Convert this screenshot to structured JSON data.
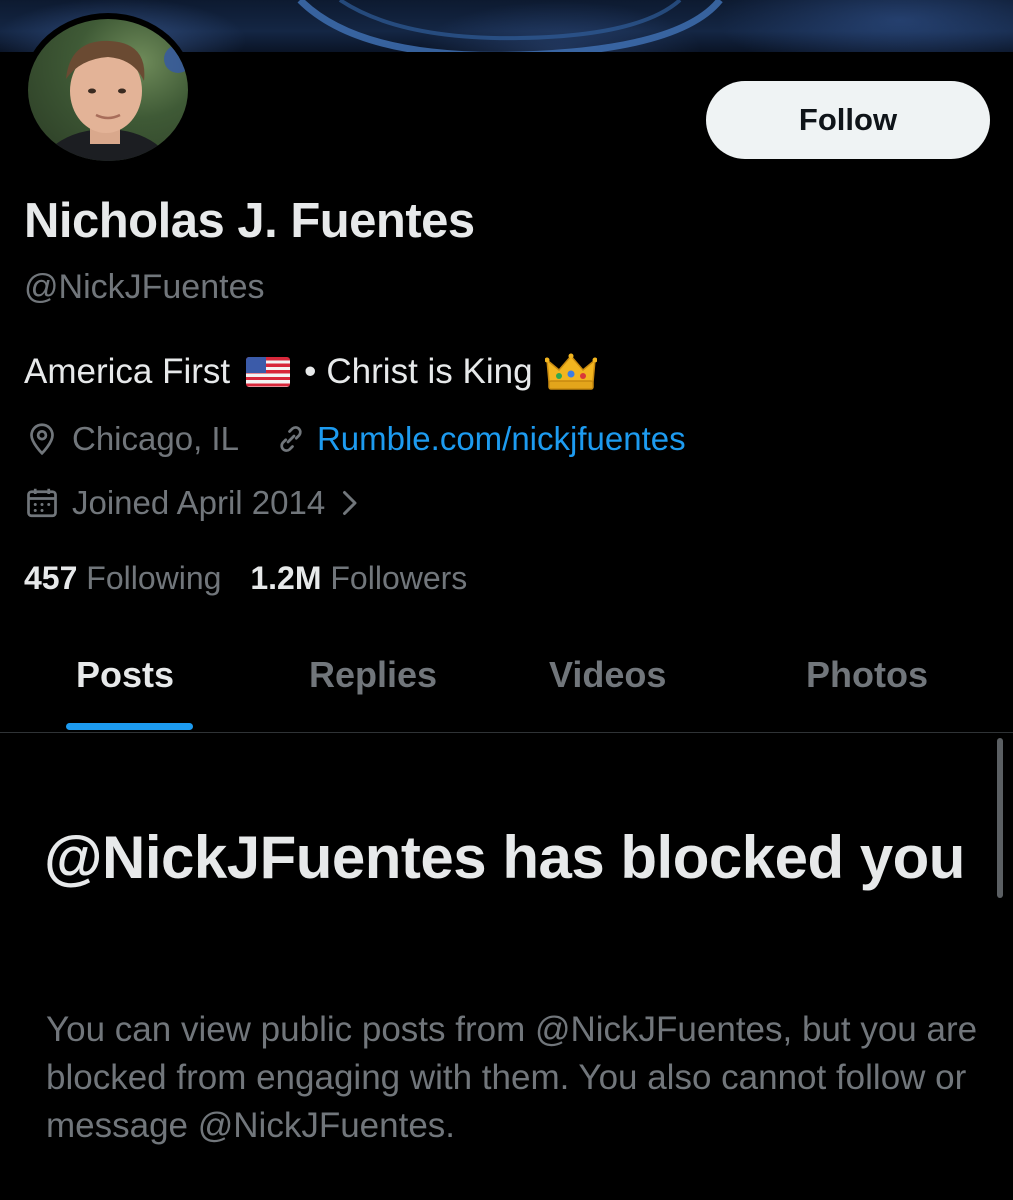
{
  "profile": {
    "display_name": "Nicholas J. Fuentes",
    "handle": "@NickJFuentes",
    "bio_part1": "America First",
    "bio_separator": "•",
    "bio_part2": "Christ is King",
    "location": "Chicago, IL",
    "website": "Rumble.com/nickjfuentes",
    "joined": "Joined April 2014",
    "following_count": "457",
    "following_label": "Following",
    "followers_count": "1.2M",
    "followers_label": "Followers"
  },
  "actions": {
    "follow_label": "Follow"
  },
  "tabs": [
    {
      "label": "Posts",
      "active": true
    },
    {
      "label": "Replies",
      "active": false
    },
    {
      "label": "Videos",
      "active": false
    },
    {
      "label": "Photos",
      "active": false
    }
  ],
  "blocked": {
    "title": "@NickJFuentes has blocked you",
    "description": "You can view public posts from @NickJFuentes, but you are blocked from engaging with them. You also cannot follow or message @NickJFuentes."
  },
  "icons": {
    "location": "location-pin-icon",
    "link": "link-icon",
    "calendar": "calendar-icon",
    "chevron": "chevron-right-icon",
    "flag": "us-flag-icon",
    "crown": "crown-icon"
  },
  "colors": {
    "background": "#000000",
    "primary_text": "#e7e9ea",
    "secondary_text": "#71767b",
    "accent": "#1d9bf0",
    "follow_button_bg": "#eff3f4"
  }
}
